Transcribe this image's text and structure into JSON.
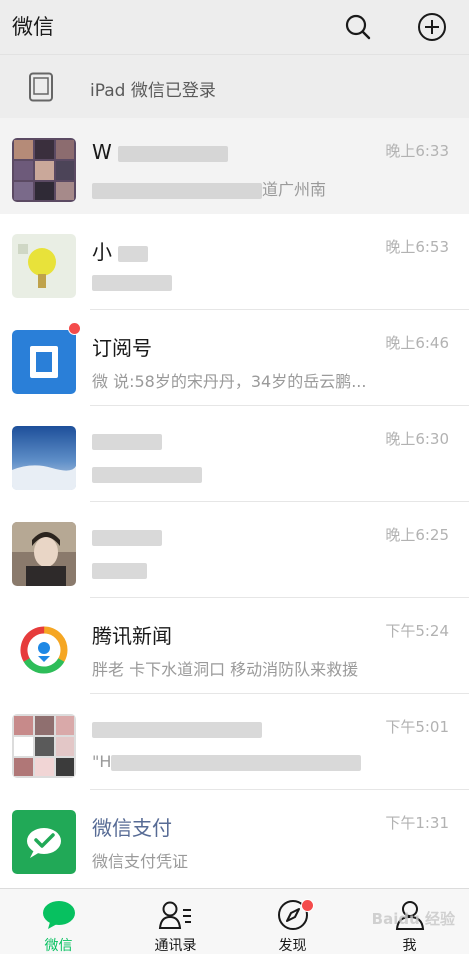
{
  "header": {
    "title": "微信",
    "icons": [
      "search-icon",
      "add-circle-icon"
    ]
  },
  "device_bar": {
    "text": "iPad 微信已登录",
    "icon": "tablet-icon"
  },
  "chats": [
    {
      "name": "W",
      "preview": "道广州南",
      "time": "晚上6:33",
      "pinned": true,
      "name_blue": false,
      "unread_dot": false
    },
    {
      "name": "小",
      "preview": "",
      "time": "晚上6:53",
      "pinned": false,
      "name_blue": false,
      "unread_dot": false
    },
    {
      "name": "订阅号",
      "preview": "微 说:58岁的宋丹丹，34岁的岳云鹏...",
      "time": "晚上6:46",
      "pinned": false,
      "name_blue": false,
      "unread_dot": true
    },
    {
      "name": "",
      "preview": "",
      "time": "晚上6:30",
      "pinned": false,
      "name_blue": false,
      "unread_dot": false
    },
    {
      "name": "",
      "preview": "",
      "time": "晚上6:25",
      "pinned": false,
      "name_blue": false,
      "unread_dot": false
    },
    {
      "name": "腾讯新闻",
      "preview": "胖老 卡下水道洞口 移动消防队来救援",
      "time": "下午5:24",
      "pinned": false,
      "name_blue": false,
      "unread_dot": false
    },
    {
      "name": "",
      "preview": "\"H",
      "time": "下午5:01",
      "pinned": false,
      "name_blue": false,
      "unread_dot": false
    },
    {
      "name": "微信支付",
      "preview": "微信支付凭证",
      "time": "下午1:31",
      "pinned": false,
      "name_blue": true,
      "unread_dot": false
    }
  ],
  "tabbar": {
    "tabs": [
      {
        "label": "微信",
        "icon": "chat-bubble-icon",
        "active": true
      },
      {
        "label": "通讯录",
        "icon": "contacts-icon",
        "active": false
      },
      {
        "label": "发现",
        "icon": "compass-icon",
        "active": false
      },
      {
        "label": "我",
        "icon": "person-icon",
        "active": false
      }
    ],
    "watermark": "Baidu 经验"
  },
  "colors": {
    "accent": "#07c160",
    "header_bg": "#ededed",
    "link_blue": "#576b95",
    "badge_red": "#f44b4b"
  }
}
